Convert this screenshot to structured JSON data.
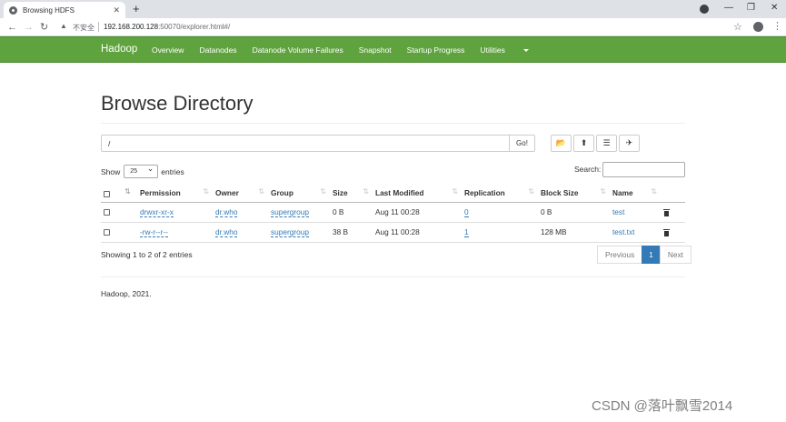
{
  "browser": {
    "tab_title": "Browsing HDFS",
    "tab_close": "✕",
    "new_tab": "+",
    "insecure_label": "不安全",
    "url_host": "192.168.200.128",
    "url_rest": ":50070/explorer.html#/"
  },
  "navbar": {
    "brand": "Hadoop",
    "links": [
      "Overview",
      "Datanodes",
      "Datanode Volume Failures",
      "Snapshot",
      "Startup Progress",
      "Utilities"
    ]
  },
  "page": {
    "title": "Browse Directory",
    "path_value": "/",
    "go_label": "Go!",
    "show_label": "Show",
    "entries_value": "25",
    "entries_label": "entries",
    "search_label": "Search:",
    "info": "Showing 1 to 2 of 2 entries",
    "prev_label": "Previous",
    "page_number": "1",
    "next_label": "Next",
    "footer": "Hadoop, 2021."
  },
  "table": {
    "headers": [
      "Permission",
      "Owner",
      "Group",
      "Size",
      "Last Modified",
      "Replication",
      "Block Size",
      "Name"
    ],
    "rows": [
      {
        "permission": "drwxr-xr-x",
        "owner": "dr.who",
        "group": "supergroup",
        "size": "0 B",
        "modified": "Aug 11 00:28",
        "replication": "0",
        "block_size": "0 B",
        "name": "test"
      },
      {
        "permission": "-rw-r--r--",
        "owner": "dr.who",
        "group": "supergroup",
        "size": "38 B",
        "modified": "Aug 11 00:28",
        "replication": "1",
        "block_size": "128 MB",
        "name": "test.txt"
      }
    ]
  },
  "watermark": "CSDN @落叶飘雪2014"
}
